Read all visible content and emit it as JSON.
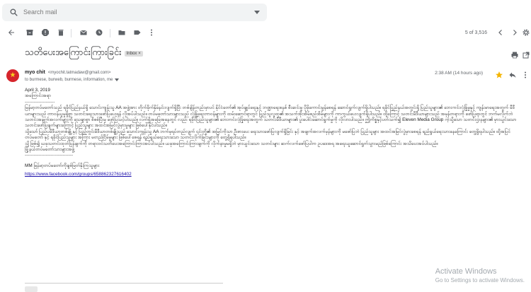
{
  "search": {
    "placeholder": "Search mail"
  },
  "toolbar": {
    "counter": "5 of 3,516"
  },
  "email": {
    "subject": "သတိပေးအကြောင်းကြားခြင်း",
    "label": "Inbox",
    "label_close": "×",
    "sender_name": "myo chit",
    "sender_email": "<myochit.tatmadaw@gmail.com>",
    "recipients": "to burmese, burweb, burmese, information, me",
    "timestamp": "2:38 AM (14 hours ago)",
    "body": {
      "date": "April 3, 2019",
      "heading": "အကြောင်းအရာ",
      "dashes": "--------------------",
      "para1": "မြန်မာ့တပ်မတော်သည် ရခိုင်ပြည်နယ်ရှိ သောင်းကျန်းသူ AA အဖွဲ့အား တိုက်ခိုက်နှိမ်နင်းလျက်ရှိပြီး တစ်ချိန်တည်းမှာပင် နိုင်ငံတော်၏ အုပ်ချုပ်ရေးနှင့် ဘဏ္ဍာရေးစနစ် စီးဆင်းမှု ပိုမိုကောင်းမွန်စေရန် ဆောင်ရွက်လျက်ရှိပါသည်။ ရခိုင်ပြည်နယ်အတွင်းရှိ ပြည်သူများ၏ ဘေးကင်းလုံခြုံမှုနှင့် ကျန်းမာရေးအတွက် မီဒီယာများသည် တာဝန်ယူမှုရှိစွာ သတင်းရေးသားဖော်ပြပေးရန် လိုအပ်ပါသည်။ တပ်မတော်သားများသည် လုံခြုံရေးတာဝန်များကို ထမ်းဆောင်ရာတွင် ပြည်သူလူထု၏ အသက်အိုးအိမ်စည်းစိမ်များကို ကာကွယ်ပေးလျက်ရှိပါသည်။ ထို့ကြောင့် သတင်းမီဒီယာများသည် အမှန်တရားကို ဖော်ပြရာတွင် ဘက်မလိုက်ဘဲ သတင်းအချက်အလက်များကို သေချာစွာ စိစစ်ပြီးမှ ဖော်ပြသင့်ပါသည်။ လက်ရှိအခြေအနေတွင် လည်း ရခိုင်ပြည်သူများ၏ ဘေးကင်းလုံခြုံရေးအတွက် သတင်းမီဒီယာများ၏ ပူးပေါင်းဆောင်ရွက်မှုကို လိုလားပါသည်။ ဤကိစ္စနှင့်ပတ်သက်၍ Eleven Media Group ကဲ့သို့သော သတင်းဌာနများ၏ မှားယွင်းသော သတင်းဖော်ပြချက်များကြောင့် ပြည်သူများ အထင်အမြင်လွဲမှားမှုများ ဖြစ်ပေါ်နိုင်ပါသည်။",
      "para2": "သို့သော် ပြည်ပမီဒီယာတစ်ချို့ နှင့် ပြည်တွင်းမီဒီယာတစ်ချို့သည် သောင်းကျန်းသူ AA ဘက်မှရပ်တည်လျက် ၎င်းတို့၏ အမြင်ကိုသာ ဦးစားပေး ရေးသားဖော်ပြလျက်ရှိခြင်း နှင့် အချက်အလက်မှန်များကို မဖော်ပြဘဲ ပြည်သူများ အထင်အမြင်လွဲမှားစေရန် ရည်ရွယ်ရေးသားနေကြောင်း တွေ့ရှိရပါသည်။ ထို့အပြင် တပ်မတော် နှင့် ရခိုင်ပြည်သူများ အကြား မတည်ငြိမ်မှုများ ဖြစ်ပေါ်စေရန် ရည်ရွယ်ရေးသားသော သတင်းလိုက်ခြင်းများကို တွေ့ရှိရပါသည်။",
      "para3": "သို့ဖြစ်၍ ယခုသတင်းထုတ်ပြန်ချက်ကို တရားဝင်သတိပေးအကြောင်းကြားအပ်ပါသည်။ ယခုအကြောင်းကြားချက်ကို လိုက်နာမှုမရှိဘဲ မှားယွင်းသော သတင်းများ ဆက်လက်ဖော်ပြပါက ဥပဒေအရ အရေးယူဆောင်ရွက်သွားမည်ဖြစ်ကြောင်း အသိပေးအပ်ပါသည်။",
      "sig_title": "မြို့နယ်တပ်မတော်သားများအဖွဲ့",
      "sig_dashes": "--------------------------------",
      "sig_org": "MM မြန်မာ့တပ်မတော်ကိုချစ်မြတ်နိုးကြသူများ",
      "sig_link": "https://www.facebook.com/groups/658862327616402"
    }
  },
  "watermark": {
    "line1": "Activate Windows",
    "line2": "Go to Settings to activate Windows."
  }
}
